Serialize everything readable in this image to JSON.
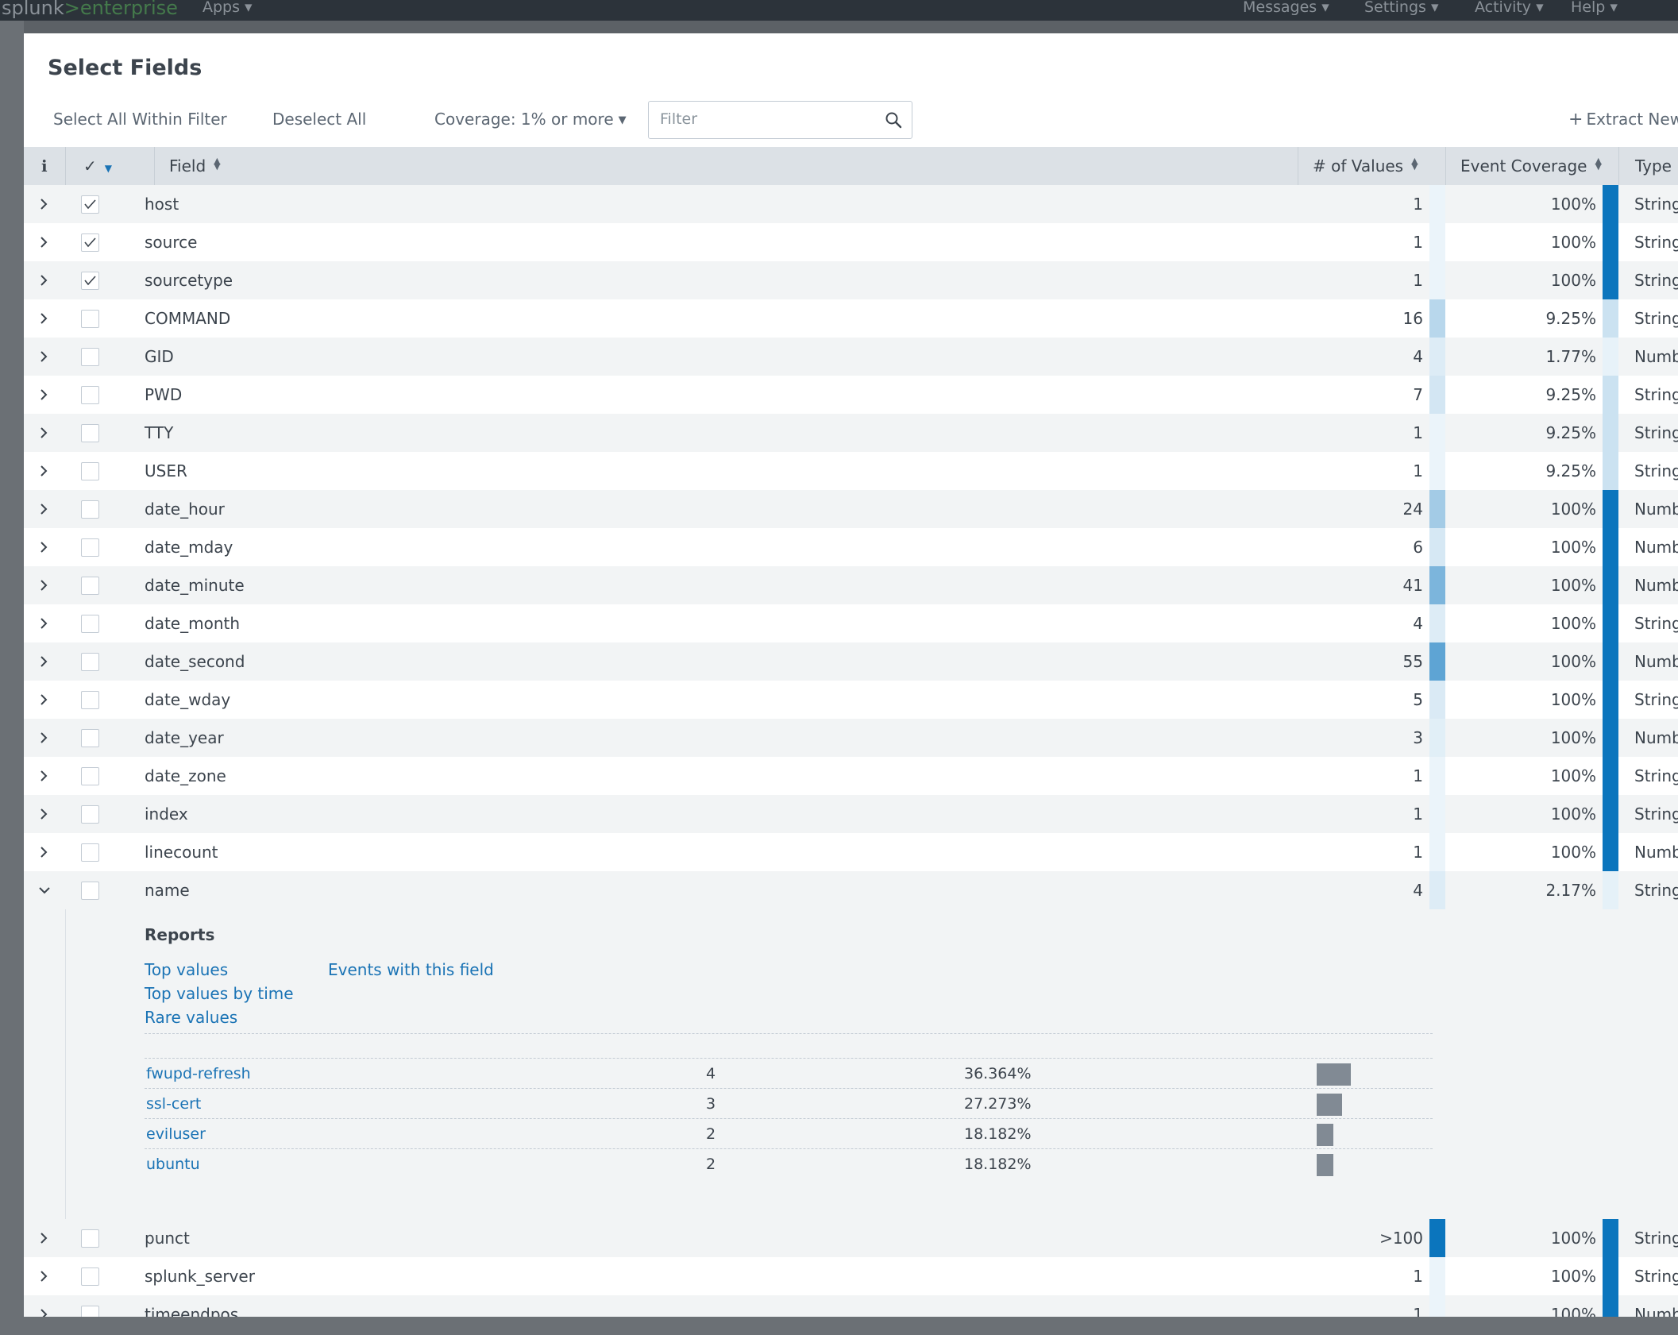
{
  "app": {
    "logo_main": "splunk",
    "logo_sep": ">",
    "logo_suffix": "enterprise",
    "nav_apps": "Apps ▾",
    "nav_messages": "Messages ▾",
    "nav_settings": "Settings ▾",
    "nav_activity": "Activity ▾",
    "nav_help": "Help ▾"
  },
  "modal": {
    "title": "Select Fields",
    "select_all_label": "Select All Within Filter",
    "deselect_all_label": "Deselect All",
    "coverage_label": "Coverage: 1% or more",
    "filter_placeholder": "Filter",
    "extract_new_label": "Extract New"
  },
  "table": {
    "headers": {
      "info": "i",
      "check": "✓",
      "field": "Field",
      "num_values": "# of Values",
      "coverage": "Event Coverage",
      "type": "Type"
    },
    "rows_top": [
      {
        "name": "host",
        "checked": true,
        "values": "1",
        "values_frac": 0.01,
        "coverage": "100%",
        "coverage_frac": 1.0,
        "type": "String"
      },
      {
        "name": "source",
        "checked": true,
        "values": "1",
        "values_frac": 0.01,
        "coverage": "100%",
        "coverage_frac": 1.0,
        "type": "String"
      },
      {
        "name": "sourcetype",
        "checked": true,
        "values": "1",
        "values_frac": 0.01,
        "coverage": "100%",
        "coverage_frac": 1.0,
        "type": "String"
      },
      {
        "name": "COMMAND",
        "checked": false,
        "values": "16",
        "values_frac": 0.16,
        "coverage": "9.25%",
        "coverage_frac": 0.0925,
        "type": "String"
      },
      {
        "name": "GID",
        "checked": false,
        "values": "4",
        "values_frac": 0.04,
        "coverage": "1.77%",
        "coverage_frac": 0.0177,
        "type": "Number"
      },
      {
        "name": "PWD",
        "checked": false,
        "values": "7",
        "values_frac": 0.07,
        "coverage": "9.25%",
        "coverage_frac": 0.0925,
        "type": "String"
      },
      {
        "name": "TTY",
        "checked": false,
        "values": "1",
        "values_frac": 0.01,
        "coverage": "9.25%",
        "coverage_frac": 0.0925,
        "type": "String"
      },
      {
        "name": "USER",
        "checked": false,
        "values": "1",
        "values_frac": 0.01,
        "coverage": "9.25%",
        "coverage_frac": 0.0925,
        "type": "String"
      },
      {
        "name": "date_hour",
        "checked": false,
        "values": "24",
        "values_frac": 0.24,
        "coverage": "100%",
        "coverage_frac": 1.0,
        "type": "Number"
      },
      {
        "name": "date_mday",
        "checked": false,
        "values": "6",
        "values_frac": 0.06,
        "coverage": "100%",
        "coverage_frac": 1.0,
        "type": "Number"
      },
      {
        "name": "date_minute",
        "checked": false,
        "values": "41",
        "values_frac": 0.41,
        "coverage": "100%",
        "coverage_frac": 1.0,
        "type": "Number"
      },
      {
        "name": "date_month",
        "checked": false,
        "values": "4",
        "values_frac": 0.04,
        "coverage": "100%",
        "coverage_frac": 1.0,
        "type": "String"
      },
      {
        "name": "date_second",
        "checked": false,
        "values": "55",
        "values_frac": 0.55,
        "coverage": "100%",
        "coverage_frac": 1.0,
        "type": "Number"
      },
      {
        "name": "date_wday",
        "checked": false,
        "values": "5",
        "values_frac": 0.05,
        "coverage": "100%",
        "coverage_frac": 1.0,
        "type": "String"
      },
      {
        "name": "date_year",
        "checked": false,
        "values": "3",
        "values_frac": 0.03,
        "coverage": "100%",
        "coverage_frac": 1.0,
        "type": "Number"
      },
      {
        "name": "date_zone",
        "checked": false,
        "values": "1",
        "values_frac": 0.01,
        "coverage": "100%",
        "coverage_frac": 1.0,
        "type": "String"
      },
      {
        "name": "index",
        "checked": false,
        "values": "1",
        "values_frac": 0.01,
        "coverage": "100%",
        "coverage_frac": 1.0,
        "type": "String"
      },
      {
        "name": "linecount",
        "checked": false,
        "values": "1",
        "values_frac": 0.01,
        "coverage": "100%",
        "coverage_frac": 1.0,
        "type": "Number"
      },
      {
        "name": "name",
        "checked": false,
        "expanded": true,
        "values": "4",
        "values_frac": 0.04,
        "coverage": "2.17%",
        "coverage_frac": 0.0217,
        "type": "String"
      }
    ],
    "expanded": {
      "reports_heading": "Reports",
      "link_top_values": "Top values",
      "link_top_by_time": "Top values by time",
      "link_rare_values": "Rare values",
      "link_events_with_field": "Events with this field",
      "values": [
        {
          "value": "fwupd-refresh",
          "count": "4",
          "percent": "36.364%",
          "frac": 0.36364
        },
        {
          "value": "ssl-cert",
          "count": "3",
          "percent": "27.273%",
          "frac": 0.27273
        },
        {
          "value": "eviluser",
          "count": "2",
          "percent": "18.182%",
          "frac": 0.18182
        },
        {
          "value": "ubuntu",
          "count": "2",
          "percent": "18.182%",
          "frac": 0.18182
        }
      ]
    },
    "rows_bottom": [
      {
        "name": "punct",
        "checked": false,
        "values": ">100",
        "values_frac": 1.0,
        "coverage": "100%",
        "coverage_frac": 1.0,
        "type": "String"
      },
      {
        "name": "splunk_server",
        "checked": false,
        "values": "1",
        "values_frac": 0.01,
        "coverage": "100%",
        "coverage_frac": 1.0,
        "type": "String"
      },
      {
        "name": "timeendpos",
        "checked": false,
        "values": "1",
        "values_frac": 0.01,
        "coverage": "100%",
        "coverage_frac": 1.0,
        "type": "Number"
      }
    ]
  },
  "colors": {
    "coverage_full": "#0b75bd",
    "link": "#1a73b5",
    "value_bar": "#818a94",
    "header_bg": "#dce1e6"
  }
}
